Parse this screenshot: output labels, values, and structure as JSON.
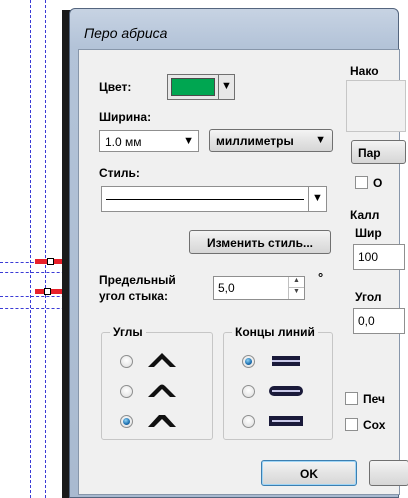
{
  "dialog": {
    "title": "Перо абриса"
  },
  "color": {
    "label": "Цвет:",
    "value": "#00a651"
  },
  "width": {
    "label": "Ширина:",
    "value": "1.0 мм",
    "units": "миллиметры"
  },
  "style": {
    "label": "Стиль:",
    "edit_button": "Изменить стиль..."
  },
  "miter": {
    "label_line1": "Предельный",
    "label_line2": "угол стыка:",
    "value": "5,0",
    "degree": "°"
  },
  "corners": {
    "title": "Углы",
    "selected_index": 2,
    "icons": [
      "miter-corner-icon",
      "round-corner-icon",
      "bevel-corner-icon"
    ]
  },
  "line_caps": {
    "title": "Концы линий",
    "selected_index": 0,
    "icons": [
      "butt-cap-icon",
      "round-cap-icon",
      "square-cap-icon"
    ]
  },
  "right_panel": {
    "arrows_label": "Нако",
    "params_button": "Пар",
    "option1": "О",
    "calligraphy_label": "Калл",
    "width_label": "Шир",
    "width_value": "100",
    "angle_label": "Угол",
    "angle_value": "0,0",
    "print_label": "Печ",
    "scale_label": "Сох"
  },
  "footer": {
    "ok": "OK"
  }
}
